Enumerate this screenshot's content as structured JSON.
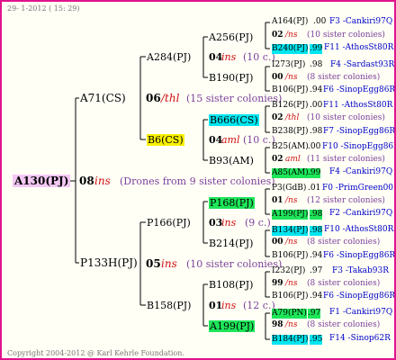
{
  "header": {
    "timestamp": "29-  1-2012 ( 15: 29)"
  },
  "footer": {
    "copyright": "Copyright 2004-2012 @ Karl Kehrle Foundation."
  },
  "root": {
    "name": "A130(PJ)",
    "colony": "08",
    "mark": "ins",
    "note": "(Drones from 9 sister colonies)"
  },
  "gen1": [
    {
      "name": "A71(CS)",
      "colony": "06",
      "mark": "/thl",
      "note": "(15 sister colonies)"
    },
    {
      "name": "P133H(PJ)",
      "colony": "05",
      "mark": "ins",
      "note": "(10 sister colonies)"
    }
  ],
  "gen2": [
    {
      "name": "A284(PJ)",
      "colony": "04",
      "mark": "ins",
      "note": "(10 c.)"
    },
    {
      "name": "B6(CS)",
      "colony": "04",
      "mark": "aml",
      "note": "(10 c.)"
    },
    {
      "name": "P166(PJ)",
      "colony": "03",
      "mark": "ins",
      "note": "(9 c.)"
    },
    {
      "name": "B158(PJ)",
      "colony": "01",
      "mark": "ins",
      "note": "(12 c.)"
    }
  ],
  "gen3": [
    {
      "name": "A256(PJ)",
      "colony": "02",
      "mark": "/ns",
      "note": "(10 sister colonies)"
    },
    {
      "name": "B190(PJ)",
      "colony": "00",
      "mark": "/ns",
      "note": "(8 sister colonies)"
    },
    {
      "name": "B666(CS)",
      "colony": "02",
      "mark": "/thl",
      "note": "(10 sister colonies)"
    },
    {
      "name": "B93(AM)",
      "colony": "02",
      "mark": "aml",
      "note": "(11 sister colonies)"
    },
    {
      "name": "P168(PJ)",
      "colony": "01",
      "mark": "/ns",
      "note": "(12 sister colonies)"
    },
    {
      "name": "B214(PJ)",
      "colony": "00",
      "mark": "/ns",
      "note": "(8 sister colonies)"
    },
    {
      "name": "B108(PJ)",
      "colony": "99",
      "mark": "/ns",
      "note": "(8 sister colonies)"
    },
    {
      "name": "A199(PJ)",
      "colony": "98",
      "mark": "/ns",
      "note": "(8 sister colonies)"
    }
  ],
  "gen4": [
    {
      "code": "A164(PJ)",
      "year": ".00",
      "breeder": "F3 -Cankiri97Q"
    },
    {
      "code": "B240(PJ)",
      "year": ".99",
      "breeder": "F11 -AthosSt80R"
    },
    {
      "code": "I273(PJ)",
      "year": ".98",
      "breeder": "F4 -Sardast93R"
    },
    {
      "code": "B106(PJ)",
      "year": ".94",
      "breeder": "F6 -SinopEgg86R"
    },
    {
      "code": "B126(PJ)",
      "year": ".00",
      "breeder": "F11 -AthosSt80R"
    },
    {
      "code": "B238(PJ)",
      "year": ".98",
      "breeder": "F7 -SinopEgg86R"
    },
    {
      "code": "B25(AM)",
      "year": ".00",
      "breeder": "F10 -SinopEgg86R"
    },
    {
      "code": "A85(AM)",
      "year": ".99",
      "breeder": "F4 -Cankiri97Q"
    },
    {
      "code": "P3(GdB)",
      "year": ".01",
      "breeder": "F0 -PrimGreen00"
    },
    {
      "code": "A199(PJ)",
      "year": ".98",
      "breeder": "F2 -Cankiri97Q"
    },
    {
      "code": "B134(PJ)",
      "year": ".98",
      "breeder": "F10 -AthosSt80R"
    },
    {
      "code": "B106(PJ)",
      "year": ".94",
      "breeder": "F6 -SinopEgg86R"
    },
    {
      "code": "I232(PJ)",
      "year": ".97",
      "breeder": "F3 -Takab93R"
    },
    {
      "code": "B106(PJ)",
      "year": ".94",
      "breeder": "F6 -SinopEgg86R"
    },
    {
      "code": "A79(PN)",
      "year": ".97",
      "breeder": "F1 -Cankiri97Q"
    },
    {
      "code": "B184(PJ)",
      "year": ".95",
      "breeder": "F14 -Sinop62R"
    }
  ]
}
